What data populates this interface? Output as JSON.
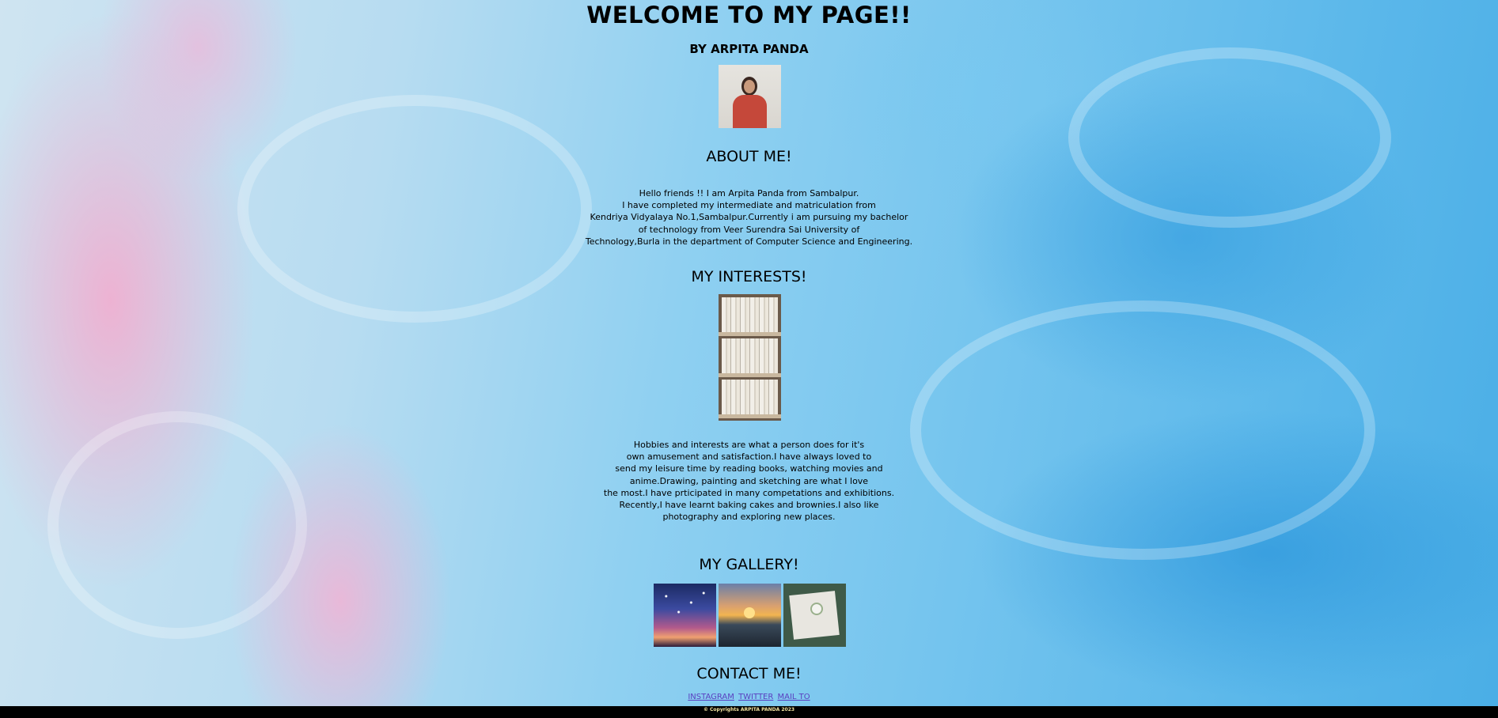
{
  "page": {
    "title": "WELCOME TO MY PAGE!!",
    "byline": "BY ARPITA PANDA"
  },
  "about": {
    "heading": "ABOUT ME!",
    "lines": [
      "Hello friends !! I am Arpita Panda from Sambalpur.",
      "I have completed my intermediate and matriculation from",
      "Kendriya Vidyalaya No.1,Sambalpur.Currently i am pursuing my bachelor",
      "of technology from Veer Surendra Sai University of",
      "Technology,Burla in the department of Computer Science and Engineering."
    ]
  },
  "interests": {
    "heading": "MY INTERESTS!",
    "lines": [
      "Hobbies and interests are what a person does for it's",
      "own amusement and satisfaction.I have always loved to",
      "send my leisure time by reading books, watching movies and",
      "anime.Drawing, painting and sketching are what I love",
      "the most.I have prticipated in many competations and exhibitions.",
      "Recently,I have learnt baking cakes and brownies.I also like",
      "photography and exploring new places."
    ]
  },
  "gallery": {
    "heading": "MY GALLERY!"
  },
  "contact": {
    "heading": "CONTACT ME!",
    "links": [
      "INSTAGRAM",
      "TWITTER",
      "MAIL TO"
    ]
  },
  "footer": {
    "text": "© Copyrights ARPITA PANDA 2023"
  },
  "colors": {
    "link": "#5a3fc0",
    "footer_bg": "#000000",
    "footer_text": "#f2e3a0"
  }
}
